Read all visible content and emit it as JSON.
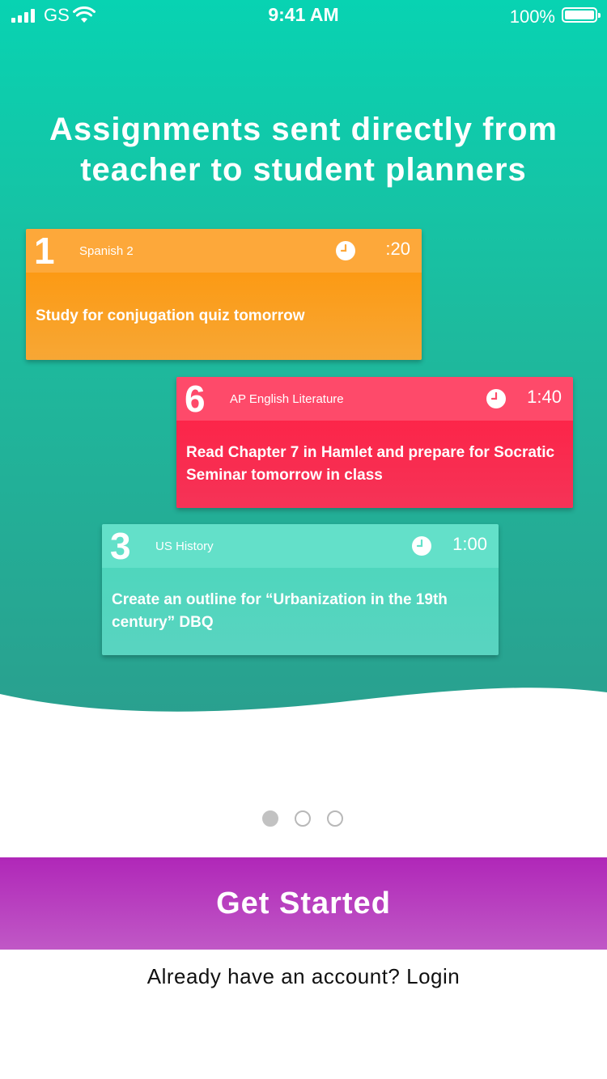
{
  "status_bar": {
    "carrier": "GS",
    "time": "9:41 AM",
    "battery_percent": "100%",
    "signal_bars": 4,
    "battery_level": 1.0
  },
  "headline": "Assignments sent directly from teacher to student planners",
  "cards": [
    {
      "number": "1",
      "subject": "Spanish 2",
      "duration": ":20",
      "task": "Study for conjugation quiz tomorrow",
      "color": "#fc9a14",
      "icon": "clock-icon"
    },
    {
      "number": "6",
      "subject": "AP English Literature",
      "duration": "1:40",
      "task": "Read Chapter 7 in Hamlet and prepare for Socratic Seminar tomorrow in class",
      "color": "#fc2549",
      "icon": "clock-icon"
    },
    {
      "number": "3",
      "subject": "US History",
      "duration": "1:00",
      "task": "Create an outline for  “Urbanization in the 19th century” DBQ",
      "color": "#4fd6bd",
      "icon": "clock-icon"
    }
  ],
  "pagination": {
    "count": 3,
    "active_index": 0
  },
  "cta": {
    "label": "Get Started",
    "color": "#b027b8"
  },
  "footer": {
    "prompt": "Already have an account?",
    "login_label": "Login"
  },
  "colors": {
    "hero_top": "#08d3b2",
    "hero_bottom": "#2a9f8e"
  }
}
